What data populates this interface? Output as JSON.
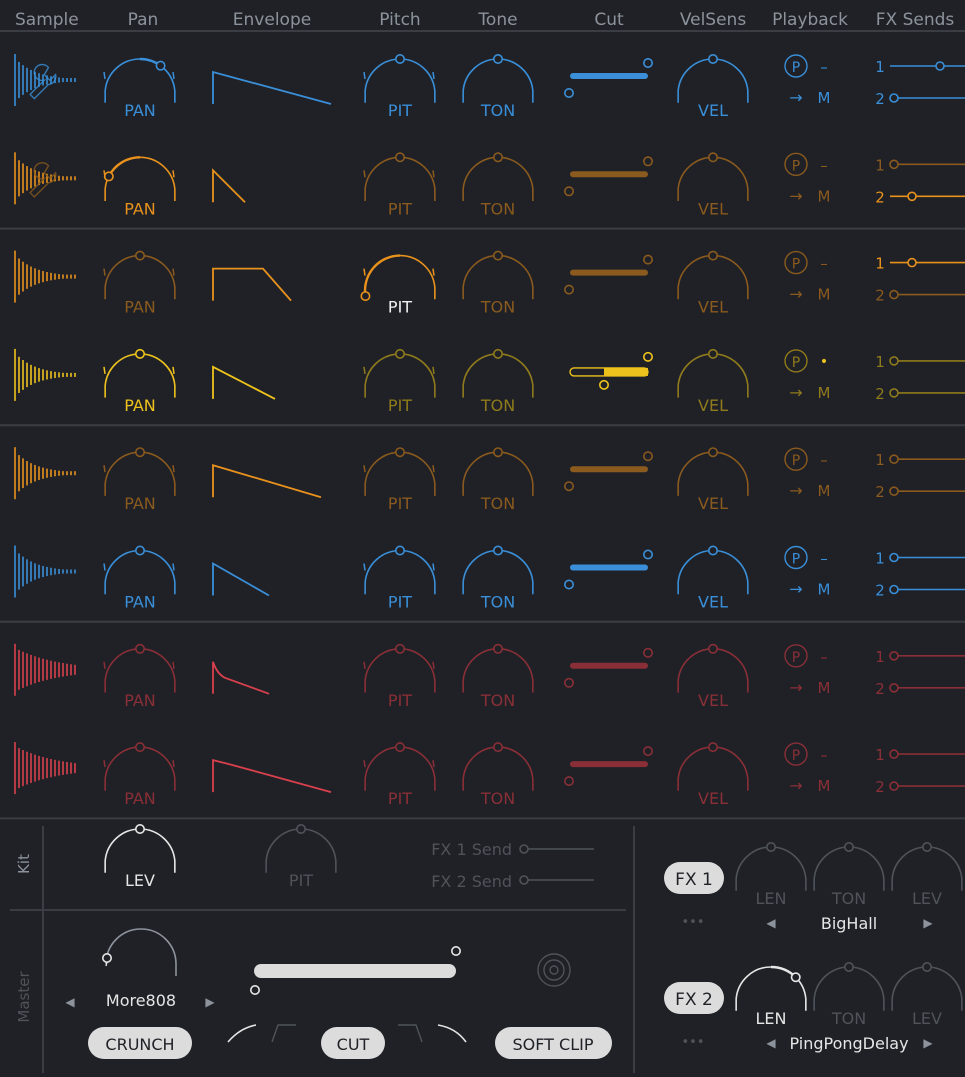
{
  "headers": {
    "sample": "Sample",
    "pan": "Pan",
    "envelope": "Envelope",
    "pitch": "Pitch",
    "tone": "Tone",
    "cut": "Cut",
    "velsens": "VelSens",
    "playback": "Playback",
    "fx_sends": "FX Sends"
  },
  "knob_labels": {
    "pan": "PAN",
    "pitch": "PIT",
    "tone": "TON",
    "vel": "VEL"
  },
  "playback_labels": {
    "p": "P",
    "dash": "–",
    "dot": "•",
    "arrow": "→",
    "mode": "M"
  },
  "send_labels": [
    "1",
    "2"
  ],
  "colors": {
    "blue": "#3a8fd8",
    "orange_bright": "#e8921d",
    "orange_dim": "#8a5a1e",
    "yellow": "#eec21c",
    "yellow_dim": "#8f7a1c",
    "red": "#d9404d",
    "red_dim": "#8a2f37",
    "bg": "#1f2126",
    "divider": "#3a3d44",
    "text_dim": "#6b7079"
  },
  "rows": [
    {
      "color": "blue",
      "dim": "blue",
      "icon": "wrench-icon",
      "pan_active": true,
      "pitch_active": false,
      "cut_active": true,
      "velsens_active": false,
      "send1_active": true,
      "send2_active": false,
      "playback_mark": "dash"
    },
    {
      "color": "orange_bright",
      "dim": "orange_dim",
      "icon": "wrench-icon",
      "pan_active": true,
      "pitch_active": false,
      "cut_active": false,
      "velsens_active": false,
      "send1_active": false,
      "send2_active": true,
      "playback_mark": "dash"
    },
    {
      "color": "orange_bright",
      "dim": "orange_dim",
      "icon": "",
      "pan_active": false,
      "pitch_active": true,
      "cut_active": false,
      "velsens_active": false,
      "send1_active": true,
      "send2_active": false,
      "playback_mark": "dash"
    },
    {
      "color": "yellow",
      "dim": "yellow_dim",
      "icon": "",
      "pan_active": true,
      "pitch_active": false,
      "cut_active": true,
      "velsens_active": false,
      "send1_active": false,
      "send2_active": false,
      "playback_mark": "dot"
    },
    {
      "color": "orange_bright",
      "dim": "orange_dim",
      "icon": "",
      "pan_active": false,
      "pitch_active": false,
      "cut_active": false,
      "velsens_active": false,
      "send1_active": false,
      "send2_active": false,
      "playback_mark": "dash"
    },
    {
      "color": "blue",
      "dim": "blue",
      "icon": "",
      "pan_active": false,
      "pitch_active": true,
      "cut_active": true,
      "velsens_active": false,
      "send1_active": false,
      "send2_active": false,
      "playback_mark": "dash"
    },
    {
      "color": "red",
      "dim": "red_dim",
      "icon": "",
      "pan_active": false,
      "pitch_active": false,
      "cut_active": false,
      "velsens_active": false,
      "send1_active": false,
      "send2_active": false,
      "playback_mark": "dash"
    },
    {
      "color": "red",
      "dim": "red_dim",
      "icon": "",
      "pan_active": false,
      "pitch_active": false,
      "cut_active": false,
      "velsens_active": false,
      "send1_active": false,
      "send2_active": false,
      "playback_mark": "dash"
    }
  ],
  "kit": {
    "section_label": "Kit",
    "lev_label": "LEV",
    "pit_label": "PIT",
    "fx1_send_label": "FX 1 Send",
    "fx2_send_label": "FX 2 Send"
  },
  "master": {
    "section_label": "Master",
    "preset_name": "More808",
    "crunch_label": "CRUNCH",
    "cut_label": "CUT",
    "soft_clip_label": "SOFT CLIP"
  },
  "fx": {
    "fx1_label": "FX 1",
    "fx2_label": "FX 2",
    "len_label": "LEN",
    "ton_label": "TON",
    "lev_label": "LEV",
    "more_label": "•••",
    "fx1_preset": "BigHall",
    "fx2_preset": "PingPongDelay",
    "prev_glyph": "◀",
    "next_glyph": "▶"
  }
}
